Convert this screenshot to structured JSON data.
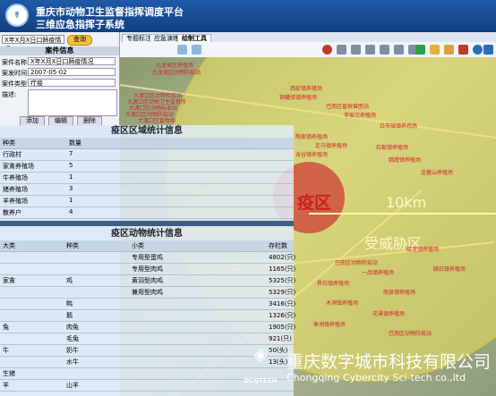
{
  "header": {
    "logo_glyph": "☤",
    "title_line1": "重庆市动物卫生监督指挥调度平台",
    "title_line2": "三维应急指挥子系统"
  },
  "left_panel": {
    "search_value": "X年X月X日口蹄疫情况",
    "search_button": "查询",
    "section_title": "案件信息",
    "fields": [
      {
        "label": "案件名称:",
        "value": "X年X月X日口蹄疫情况"
      },
      {
        "label": "案发时间:",
        "value": "2007-05-02"
      },
      {
        "label": "案件类型:",
        "value": "疔疫"
      },
      {
        "label": "描述:",
        "value": ""
      }
    ],
    "buttons": [
      "添加",
      "编辑",
      "删除"
    ]
  },
  "tabs": [
    "专题标注",
    "应急演练",
    "绘制工具"
  ],
  "active_tab": 2,
  "map": {
    "epidemic_label": "疫区",
    "radius_label": "10km",
    "threat_label": "受威胁区",
    "labels": [
      "九龙坡区养殖场",
      "九龙坡区动物防疫站",
      "大渡口区动物检疫站",
      "大渡口区动物卫生监督所",
      "大渡口区动物标本站",
      "大渡口区动物防疫站",
      "大渡口区畜牧局",
      "西彭镇养猪场",
      "铜罐驿镇养殖场",
      "巴南区畜牧兽医站",
      "李家沱养殖场",
      "白市驿镇养鸡场",
      "陶家镇养殖场",
      "走马镇养殖场",
      "石板镇养殖场",
      "含谷镇养殖场",
      "跳蹬镇养殖场",
      "金鳌山养殖场",
      "巴南区动物检疫站",
      "一品镇养殖场",
      "界石镇养殖场",
      "南泉镇养殖场",
      "木洞镇养殖场",
      "花溪镇养殖场",
      "鱼洞镇养殖场",
      "巴南区动物防疫站",
      "接龙镇养殖场",
      "跳石镇养殖场"
    ]
  },
  "epidemic_stats": {
    "title": "疫区区域统计信息",
    "header": [
      "种类",
      "数量"
    ],
    "rows": [
      [
        "行政村",
        "7"
      ],
      [
        "家禽养殖场",
        "5"
      ],
      [
        "牛养殖场",
        "1"
      ],
      [
        "猪养殖场",
        "3"
      ],
      [
        "羊养殖场",
        "1"
      ],
      [
        "散养户",
        "4"
      ]
    ]
  },
  "animal_stats": {
    "title": "疫区动物统计信息",
    "header": [
      "大类",
      "种类",
      "小类",
      "存栏数"
    ],
    "rows": [
      [
        "",
        "",
        "专用型蛋鸡",
        "4802(只)"
      ],
      [
        "",
        "",
        "专用型肉鸡",
        "1165(只)"
      ],
      [
        "家禽",
        "鸡",
        "黄羽型肉鸡",
        "5325(只)"
      ],
      [
        "",
        "",
        "兼用型肉鸡",
        "5329(只)"
      ],
      [
        "",
        "鸭",
        "",
        "3416(只)"
      ],
      [
        "",
        "鹅",
        "",
        "1326(只)"
      ],
      [
        "兔",
        "肉兔",
        "",
        "1905(只)"
      ],
      [
        "",
        "毛兔",
        "",
        "921(只)"
      ],
      [
        "牛",
        "奶牛",
        "",
        "50(头)"
      ],
      [
        "",
        "水牛",
        "",
        "13(头)"
      ],
      [
        "生猪",
        "",
        "",
        ""
      ],
      [
        "羊",
        "山羊",
        "",
        ""
      ]
    ]
  },
  "watermark": {
    "logo_text": "DCQTECH",
    "company_cn": "重庆数字城市科技有限公司",
    "company_en": "Chongqing Cybercity Sci-tech co.,ltd"
  },
  "colors": {
    "header": "#1e5aa8",
    "epidemic_zone": "#cd3c37",
    "threat_zone": "#f5e85a"
  }
}
